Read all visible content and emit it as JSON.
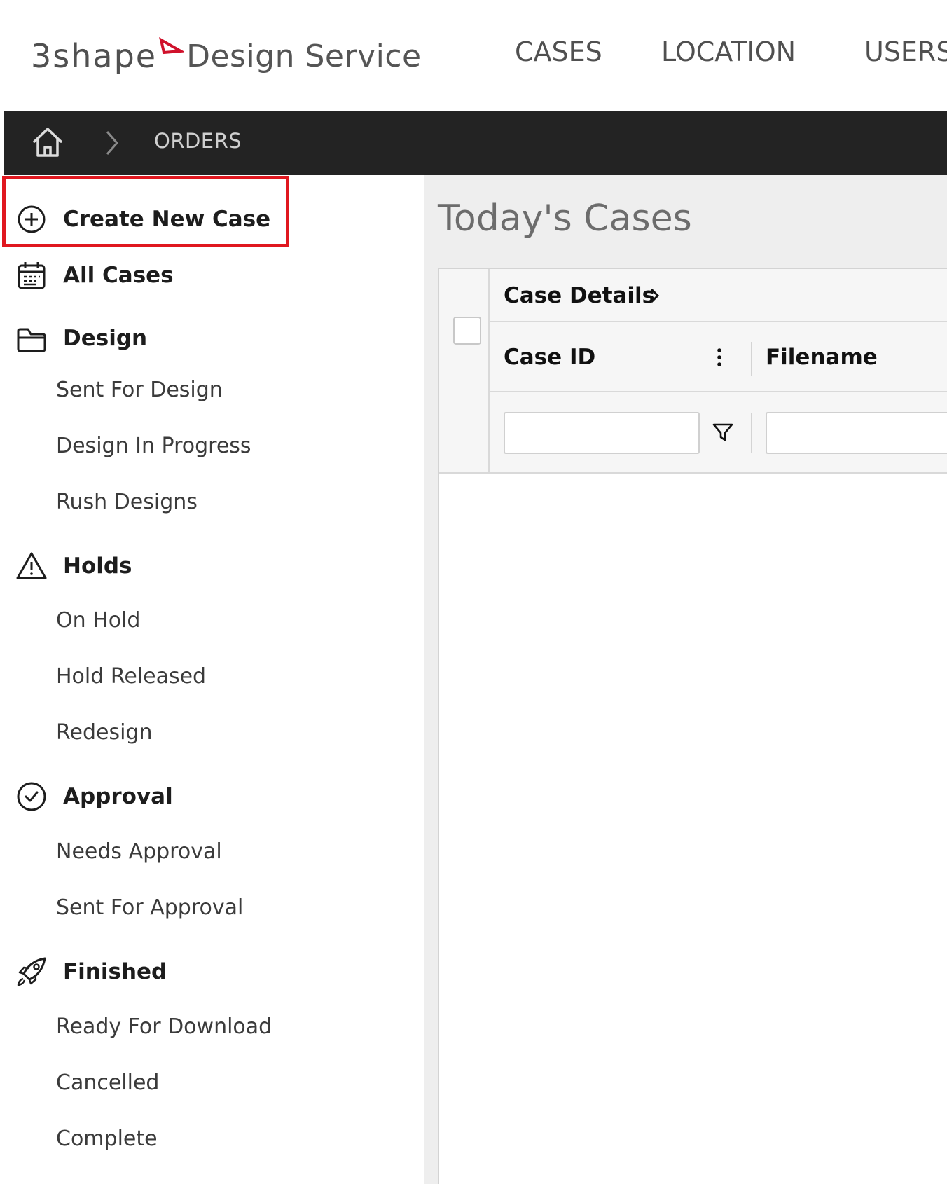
{
  "header": {
    "brand": "3shape",
    "product": "Design Service",
    "nav": [
      "CASES",
      "LOCATION",
      "USERS"
    ],
    "brand_accent_color": "#d0112b"
  },
  "breadcrumb": {
    "current": "ORDERS"
  },
  "sidebar": {
    "create": "Create New Case",
    "all_cases": "All Cases",
    "groups": {
      "design": {
        "label": "Design",
        "items": [
          "Sent For Design",
          "Design In Progress",
          "Rush Designs"
        ]
      },
      "holds": {
        "label": "Holds",
        "items": [
          "On Hold",
          "Hold Released",
          "Redesign"
        ]
      },
      "approval": {
        "label": "Approval",
        "items": [
          "Needs Approval",
          "Sent For Approval"
        ]
      },
      "finished": {
        "label": "Finished",
        "items": [
          "Ready For Download",
          "Cancelled",
          "Complete"
        ]
      }
    },
    "highlight_color": "#e0171f"
  },
  "main": {
    "title": "Today's Cases",
    "grid": {
      "group_header": "Case Details",
      "columns": [
        "Case ID",
        "Filename"
      ],
      "filter_values": [
        "",
        ""
      ]
    }
  }
}
